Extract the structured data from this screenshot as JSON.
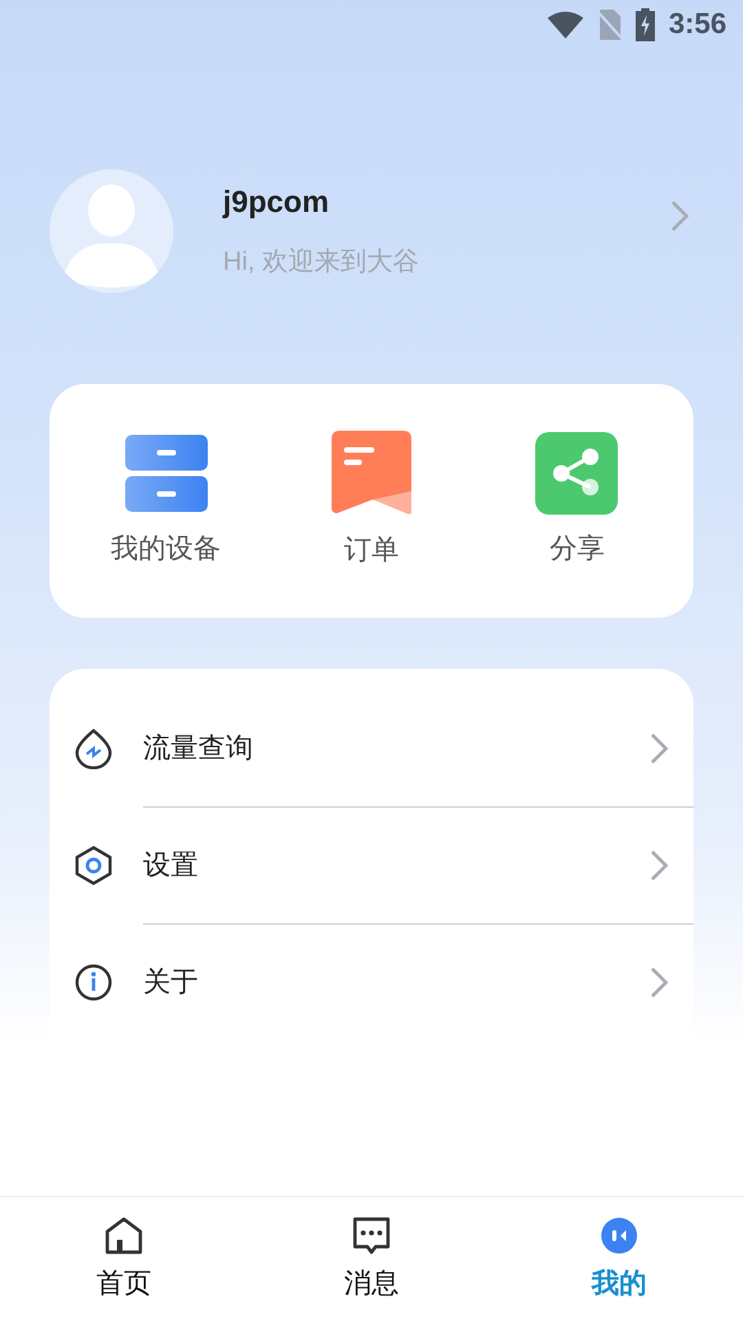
{
  "status_bar": {
    "time": "3:56"
  },
  "profile": {
    "username": "j9pcom",
    "greeting": "Hi, 欢迎来到大谷"
  },
  "shortcuts": [
    {
      "label": "我的设备"
    },
    {
      "label": "订单"
    },
    {
      "label": "分享"
    }
  ],
  "menu": [
    {
      "label": "流量查询"
    },
    {
      "label": "设置"
    },
    {
      "label": "关于"
    }
  ],
  "tab_bar": [
    {
      "label": "首页",
      "selected": false
    },
    {
      "label": "消息",
      "selected": false
    },
    {
      "label": "我的",
      "selected": true
    }
  ]
}
